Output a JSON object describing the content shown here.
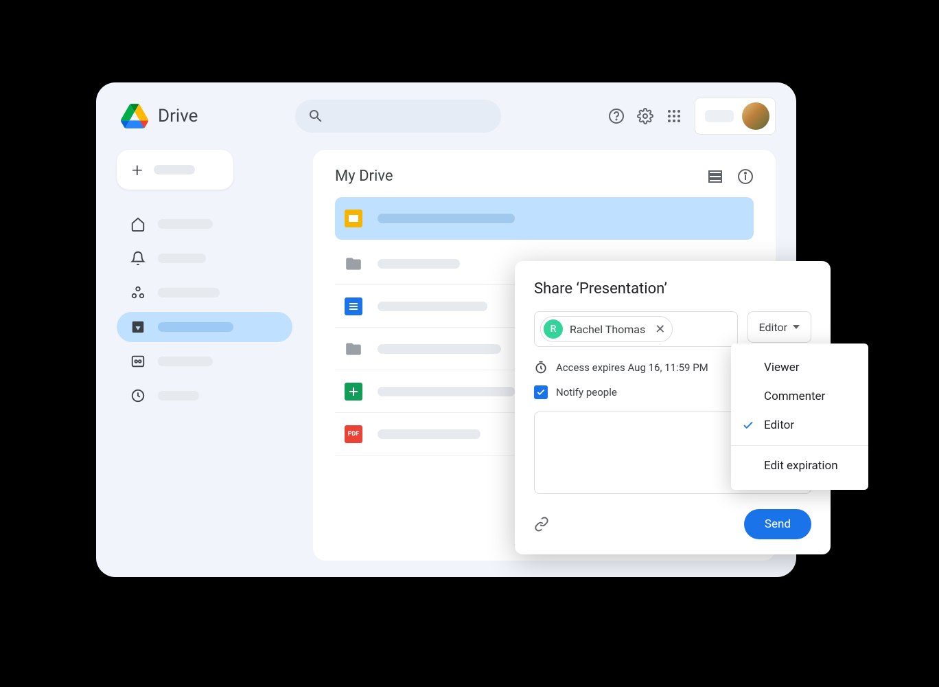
{
  "app": {
    "title": "Drive"
  },
  "main": {
    "title": "My Drive"
  },
  "share": {
    "title": "Share ‘Presentation’",
    "person_name": "Rachel Thomas",
    "person_initial": "R",
    "role_label": "Editor",
    "expires_text": "Access expires Aug 16, 11:59 PM",
    "notify_label": "Notify people",
    "send_label": "Send"
  },
  "menu": {
    "viewer": "Viewer",
    "commenter": "Commenter",
    "editor": "Editor",
    "edit_exp": "Edit expiration"
  }
}
